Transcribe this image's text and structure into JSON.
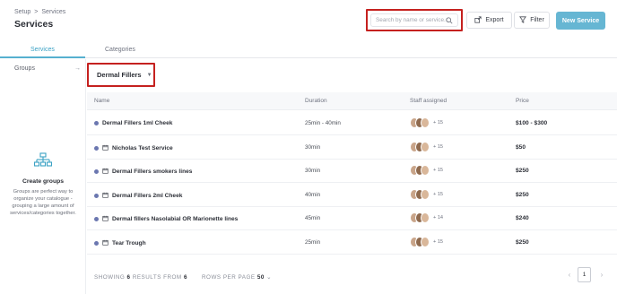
{
  "breadcrumb": {
    "root": "Setup",
    "separator": ">",
    "current": "Services"
  },
  "page_title": "Services",
  "search": {
    "placeholder": "Search by name or service...",
    "value": ""
  },
  "toolbar": {
    "export_label": "Export",
    "filter_label": "Filter",
    "new_label": "New Service"
  },
  "tabs": [
    {
      "label": "Services",
      "active": true
    },
    {
      "label": "Categories",
      "active": false
    }
  ],
  "sidebar": {
    "groups_label": "Groups",
    "empty_title": "Create groups",
    "empty_desc": "Groups are perfect way to organize your catalogue - grouping a large amount of services/categories together."
  },
  "category_select": {
    "selected": "Dermal Fillers"
  },
  "table": {
    "headers": {
      "name": "Name",
      "duration": "Duration",
      "staff": "Staff assigned",
      "price": "Price"
    },
    "rows": [
      {
        "name": "Dermal Fillers 1ml Cheek",
        "duration": "25min - 40min",
        "staff_more": "+ 15",
        "price": "$100 - $300",
        "icon": "dot"
      },
      {
        "name": "Nicholas Test Service",
        "duration": "30min",
        "staff_more": "+ 15",
        "price": "$50",
        "icon": "calendar-icon"
      },
      {
        "name": "Dermal Fillers smokers lines",
        "duration": "30min",
        "staff_more": "+ 15",
        "price": "$250",
        "icon": "calendar-icon"
      },
      {
        "name": "Dermal Fillers 2ml Cheek",
        "duration": "40min",
        "staff_more": "+ 15",
        "price": "$250",
        "icon": "calendar-icon"
      },
      {
        "name": "Dermal fillers Nasolabial OR Marionette lines",
        "duration": "45min",
        "staff_more": "+ 14",
        "price": "$240",
        "icon": "calendar-icon"
      },
      {
        "name": "Tear Trough",
        "duration": "25min",
        "staff_more": "+ 15",
        "price": "$250",
        "icon": "calendar-icon"
      }
    ]
  },
  "footer": {
    "showing_prefix": "SHOWING",
    "showing_count": "6",
    "showing_mid": "RESULTS FROM",
    "showing_total": "6",
    "rows_label": "ROWS PER PAGE",
    "rows_value": "50",
    "page": "1"
  },
  "colors": {
    "accent": "#66b6d3",
    "highlight": "#c5211f",
    "dot": "#6b77b0"
  }
}
